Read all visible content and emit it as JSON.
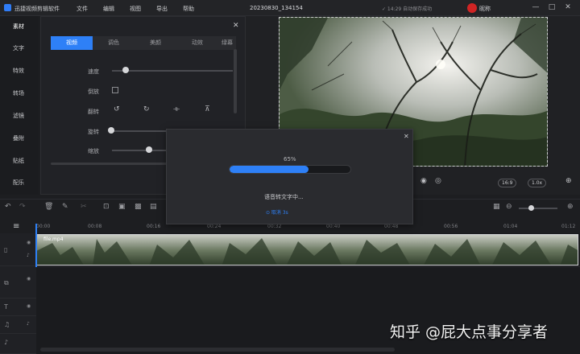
{
  "titlebar": {
    "app_name": "迅捷视频剪辑软件",
    "menu": [
      "文件",
      "编辑",
      "视图",
      "导出",
      "帮助"
    ],
    "doc_title": "20230830_134154",
    "save_status": "✓ 14:29 自动保存成功",
    "user": "昵称",
    "win": [
      "—",
      "□",
      "✕"
    ]
  },
  "sidenav": {
    "items": [
      "素材",
      "文字",
      "特效",
      "转场",
      "滤镜",
      "叠附",
      "贴纸",
      "配乐"
    ],
    "active_index": 0
  },
  "panel": {
    "tabs": [
      "视频",
      "调色",
      "美颜",
      "动效",
      "绿幕"
    ],
    "active_tab": 0,
    "rows": {
      "speed": "速度",
      "reverse": "倒放",
      "flip": "翻转",
      "rotate": "旋转",
      "scale": "缩放"
    },
    "speed_level": 0.1,
    "rotate_level": 0,
    "scale_level": 0.32
  },
  "preview": {
    "aspect": "16:9",
    "zoom": "1.0x"
  },
  "ruler": {
    "ticks": [
      "00:00",
      "00:08",
      "00:16",
      "00:24",
      "00:32",
      "00:40",
      "00:48",
      "00:56",
      "01:04",
      "01:12"
    ]
  },
  "timeline": {
    "clip_name": "file.mp4"
  },
  "dialog": {
    "percent": "65%",
    "progress": 0.65,
    "status": "语音转文字中...",
    "cancel": "⊙ 取消 3s"
  },
  "watermark": "知乎 @屁大点事分享者",
  "colors": {
    "accent": "#2e80f7",
    "bg": "#1d1e21"
  }
}
